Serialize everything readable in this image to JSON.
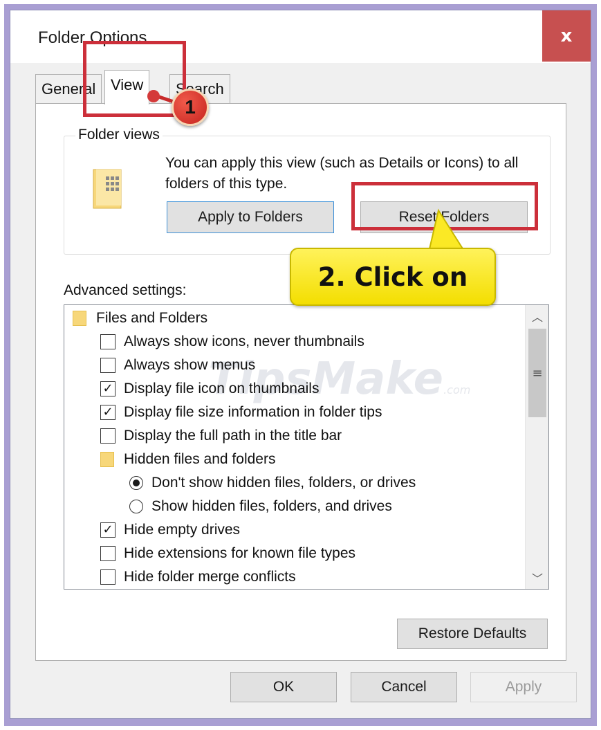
{
  "window": {
    "title": "Folder Options",
    "close_label": "x"
  },
  "tabs": [
    {
      "label": "General",
      "active": false
    },
    {
      "label": "View",
      "active": true
    },
    {
      "label": "Search",
      "active": false
    }
  ],
  "folder_views": {
    "group_label": "Folder views",
    "description": "You can apply this view (such as Details or Icons) to all folders of this type.",
    "apply_button": "Apply to Folders",
    "reset_button": "Reset Folders"
  },
  "advanced": {
    "label": "Advanced settings:",
    "items": [
      {
        "type": "folder",
        "label": "Files and Folders"
      },
      {
        "type": "checkbox",
        "label": "Always show icons, never thumbnails",
        "checked": false
      },
      {
        "type": "checkbox",
        "label": "Always show menus",
        "checked": false
      },
      {
        "type": "checkbox",
        "label": "Display file icon on thumbnails",
        "checked": true
      },
      {
        "type": "checkbox",
        "label": "Display file size information in folder tips",
        "checked": true
      },
      {
        "type": "checkbox",
        "label": "Display the full path in the title bar",
        "checked": false
      },
      {
        "type": "folder",
        "label": "Hidden files and folders"
      },
      {
        "type": "radio",
        "label": "Don't show hidden files, folders, or drives",
        "checked": true
      },
      {
        "type": "radio",
        "label": "Show hidden files, folders, and drives",
        "checked": false
      },
      {
        "type": "checkbox",
        "label": "Hide empty drives",
        "checked": true
      },
      {
        "type": "checkbox",
        "label": "Hide extensions for known file types",
        "checked": false
      },
      {
        "type": "checkbox",
        "label": "Hide folder merge conflicts",
        "checked": false
      }
    ],
    "restore_button": "Restore Defaults"
  },
  "footer": {
    "ok": "OK",
    "cancel": "Cancel",
    "apply": "Apply"
  },
  "annotations": {
    "step1_badge": "1",
    "step2_callout": "2. Click on",
    "highlight_color": "#cc2f3a",
    "callout_color": "#f8e81c"
  },
  "watermark": {
    "text": "TipsMake",
    "suffix": ".com"
  },
  "icons": {
    "close": "close-icon",
    "folder": "folder-icon",
    "check": "checkmark-icon",
    "scroll_up": "chevron-up-icon",
    "scroll_down": "chevron-down-icon",
    "scroll_grip": "grip-icon"
  }
}
